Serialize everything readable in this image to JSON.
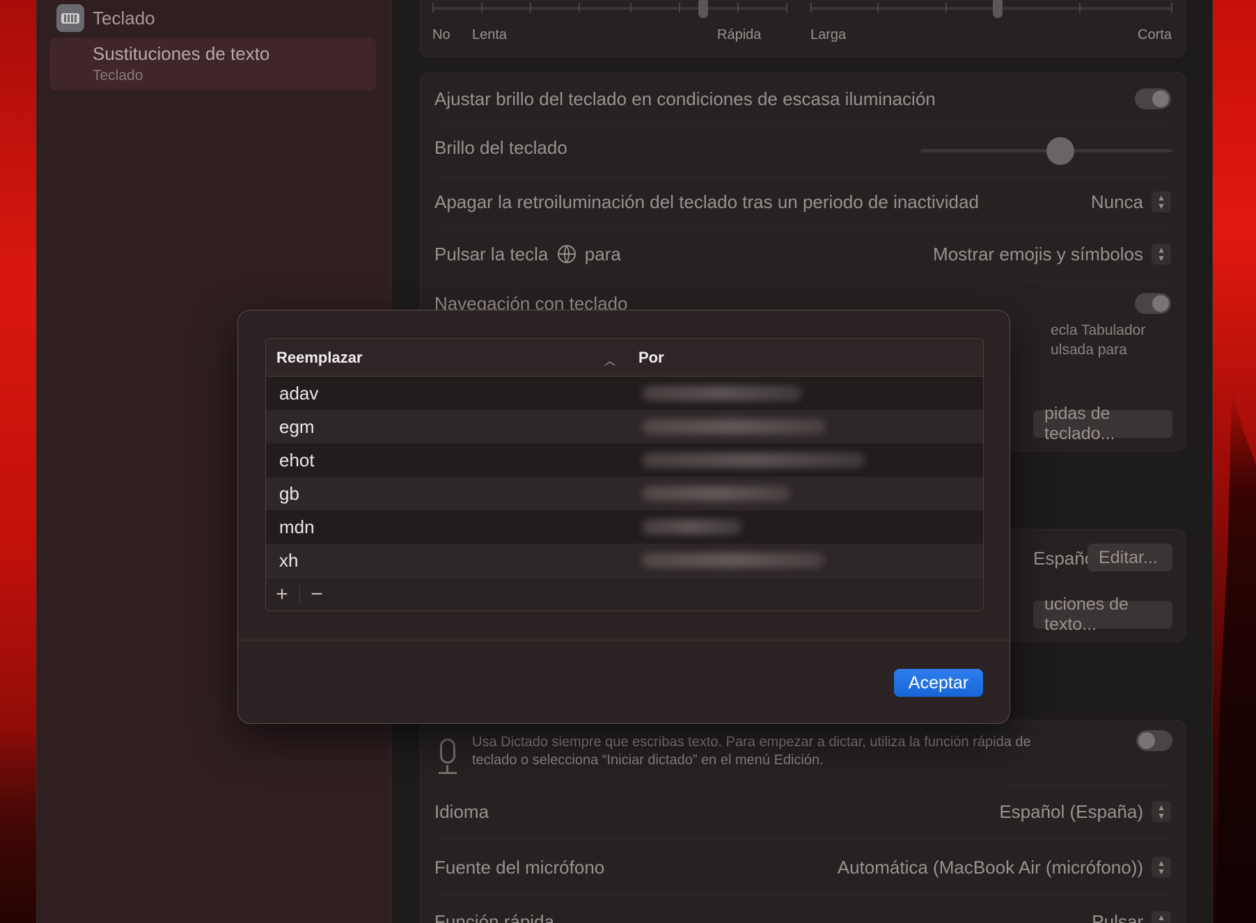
{
  "sidebar": {
    "teclado_label": "Teclado",
    "selected_title": "Sustituciones de texto",
    "selected_subtitle": "Teclado"
  },
  "settings": {
    "repeat_labels": {
      "no": "No",
      "lenta": "Lenta",
      "rapida": "Rápida",
      "larga": "Larga",
      "corta": "Corta"
    },
    "adjust_brightness_label": "Ajustar brillo del teclado en condiciones de escasa iluminación",
    "brightness_label": "Brillo del teclado",
    "backlight_off_label": "Apagar la retroiluminación del teclado tras un periodo de inactividad",
    "backlight_off_value": "Nunca",
    "globe_key_label_before": "Pulsar la tecla",
    "globe_key_label_after": "para",
    "globe_key_value": "Mostrar emojis y símbolos",
    "keyboard_nav_label": "Navegación con teclado",
    "keyboard_nav_desc_line1": "ecla Tabulador",
    "keyboard_nav_desc_line2": "ulsada para",
    "shortcuts_button": "pidas de teclado...",
    "input_source_value": "Español",
    "edit_button": "Editar...",
    "text_replacements_button": "uciones de texto...",
    "dictation_desc_line1": "Usa Dictado siempre que escribas texto. Para empezar a dictar, utiliza la función rápida de",
    "dictation_desc_line2": "teclado o selecciona “Iniciar dictado” en el menú Edición.",
    "language_label": "Idioma",
    "language_value": "Español (España)",
    "mic_source_label": "Fuente del micrófono",
    "mic_source_value": "Automática (MacBook Air (micrófono))",
    "shortcut_label": "Función rápida",
    "shortcut_value": "Pulsar"
  },
  "sheet": {
    "columns": {
      "replace": "Reemplazar",
      "with": "Por"
    },
    "rows": [
      {
        "replace": "adav"
      },
      {
        "replace": "egm"
      },
      {
        "replace": "ehot"
      },
      {
        "replace": "gb"
      },
      {
        "replace": "mdn"
      },
      {
        "replace": "xh"
      }
    ],
    "add_label": "+",
    "remove_label": "−",
    "accept_button": "Aceptar"
  },
  "colors": {
    "accent": "#1f73e6",
    "window_bg": "#1e1b1b",
    "sidebar_bg": "#2f1f21",
    "wallpaper": "#d0140c"
  },
  "icons": [
    "keyboard-icon",
    "globe-icon",
    "microphone-icon",
    "sort-ascending-icon",
    "chevron-updown-icon"
  ]
}
